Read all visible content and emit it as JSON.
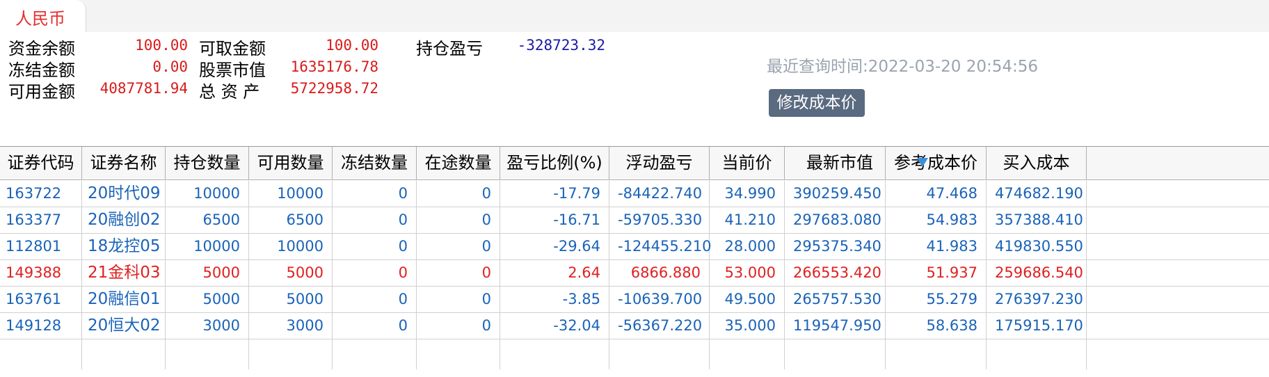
{
  "tab": {
    "label": "人民币"
  },
  "summary": {
    "fund_balance_label": "资金余额",
    "fund_balance": "100.00",
    "withdrawable_label": "可取金额",
    "withdrawable": "100.00",
    "position_pnl_label": "持仓盈亏",
    "position_pnl": "-328723.32",
    "frozen_label": "冻结金额",
    "frozen": "0.00",
    "stock_value_label": "股票市值",
    "stock_value": "1635176.78",
    "available_label": "可用金额",
    "available": "4087781.94",
    "total_assets_label": "总 资 产",
    "total_assets": "5722958.72",
    "query_time": "最近查询时间:2022-03-20 20:54:56",
    "edit_cost_button": "修改成本价"
  },
  "colors": {
    "accent_red": "#d91a1a",
    "link_blue": "#1a63b8",
    "navy": "#1a1aa8",
    "button_bg": "#5a6a80",
    "sort_icon": "#3b8fd9"
  },
  "table": {
    "headers": [
      "证券代码",
      "证券名称",
      "持仓数量",
      "可用数量",
      "冻结数量",
      "在途数量",
      "盈亏比例(%)",
      "浮动盈亏",
      "当前价",
      "最新市值",
      "参考成本价",
      "买入成本"
    ],
    "sort_icon": "sort-descending-triangle",
    "rows": [
      [
        "163722",
        "20时代09",
        "10000",
        "10000",
        "0",
        "0",
        "-17.79",
        "-84422.740",
        "34.990",
        "390259.450",
        "47.468",
        "474682.190"
      ],
      [
        "163377",
        "20融创02",
        "6500",
        "6500",
        "0",
        "0",
        "-16.71",
        "-59705.330",
        "41.210",
        "297683.080",
        "54.983",
        "357388.410"
      ],
      [
        "112801",
        "18龙控05",
        "10000",
        "10000",
        "0",
        "0",
        "-29.64",
        "-124455.210",
        "28.000",
        "295375.340",
        "41.983",
        "419830.550"
      ],
      [
        "149388",
        "21金科03",
        "5000",
        "5000",
        "0",
        "0",
        "2.64",
        "6866.880",
        "53.000",
        "266553.420",
        "51.937",
        "259686.540"
      ],
      [
        "163761",
        "20融信01",
        "5000",
        "5000",
        "0",
        "0",
        "-3.85",
        "-10639.700",
        "49.500",
        "265757.530",
        "55.279",
        "276397.230"
      ],
      [
        "149128",
        "20恒大02",
        "3000",
        "3000",
        "0",
        "0",
        "-32.04",
        "-56367.220",
        "35.000",
        "119547.950",
        "58.638",
        "175915.170"
      ]
    ]
  }
}
